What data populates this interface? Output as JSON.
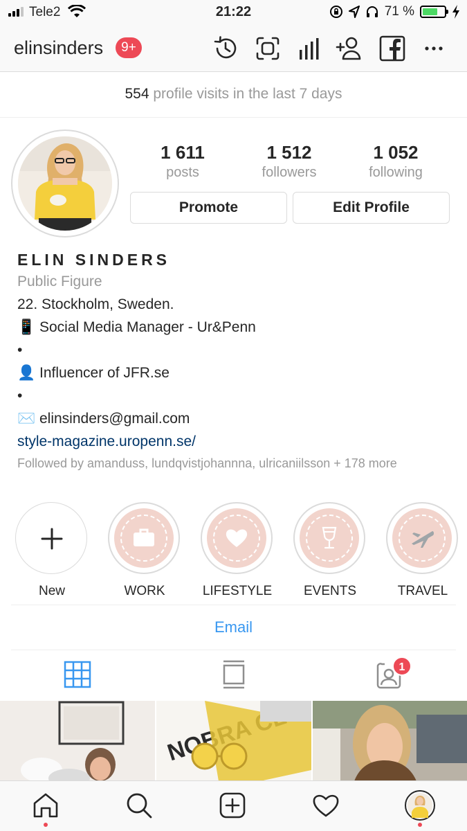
{
  "status_bar": {
    "carrier": "Tele2",
    "time": "21:22",
    "battery": "71 %",
    "battery_level": 0.71
  },
  "header": {
    "username": "elinsinders",
    "notification_badge": "9+"
  },
  "insights": {
    "count": "554",
    "text": " profile visits in the last 7 days"
  },
  "stats": {
    "posts_value": "1 611",
    "posts_label": "posts",
    "followers_value": "1 512",
    "followers_label": "followers",
    "following_value": "1 052",
    "following_label": "following"
  },
  "buttons": {
    "promote": "Promote",
    "edit_profile": "Edit Profile"
  },
  "bio": {
    "name": "ELIN SINDERS",
    "category": "Public Figure",
    "line1": "22. Stockholm, Sweden.",
    "line2": "📱 Social Media Manager - Ur&Penn",
    "line3": "•",
    "line4": "👤 Influencer of JFR.se",
    "line5": "•",
    "line6": "✉️ elinsinders@gmail.com",
    "link": "style-magazine.uropenn.se/",
    "followed_by": "Followed by amanduss, lundqvistjohannna, ulricaniilsson + 178 more"
  },
  "highlights": [
    {
      "label": "New",
      "icon": "plus-icon"
    },
    {
      "label": "WORK",
      "icon": "briefcase-icon"
    },
    {
      "label": "LIFESTYLE",
      "icon": "heart-icon"
    },
    {
      "label": "EVENTS",
      "icon": "wine-glass-icon"
    },
    {
      "label": "TRAVEL",
      "icon": "airplane-icon"
    }
  ],
  "contact": {
    "email_label": "Email"
  },
  "tabs": {
    "tagged_badge": "1"
  },
  "colors": {
    "accent_blue": "#3897f0",
    "badge_red": "#ed4956",
    "highlight_pink": "#f2d4cc",
    "link_navy": "#003569"
  }
}
